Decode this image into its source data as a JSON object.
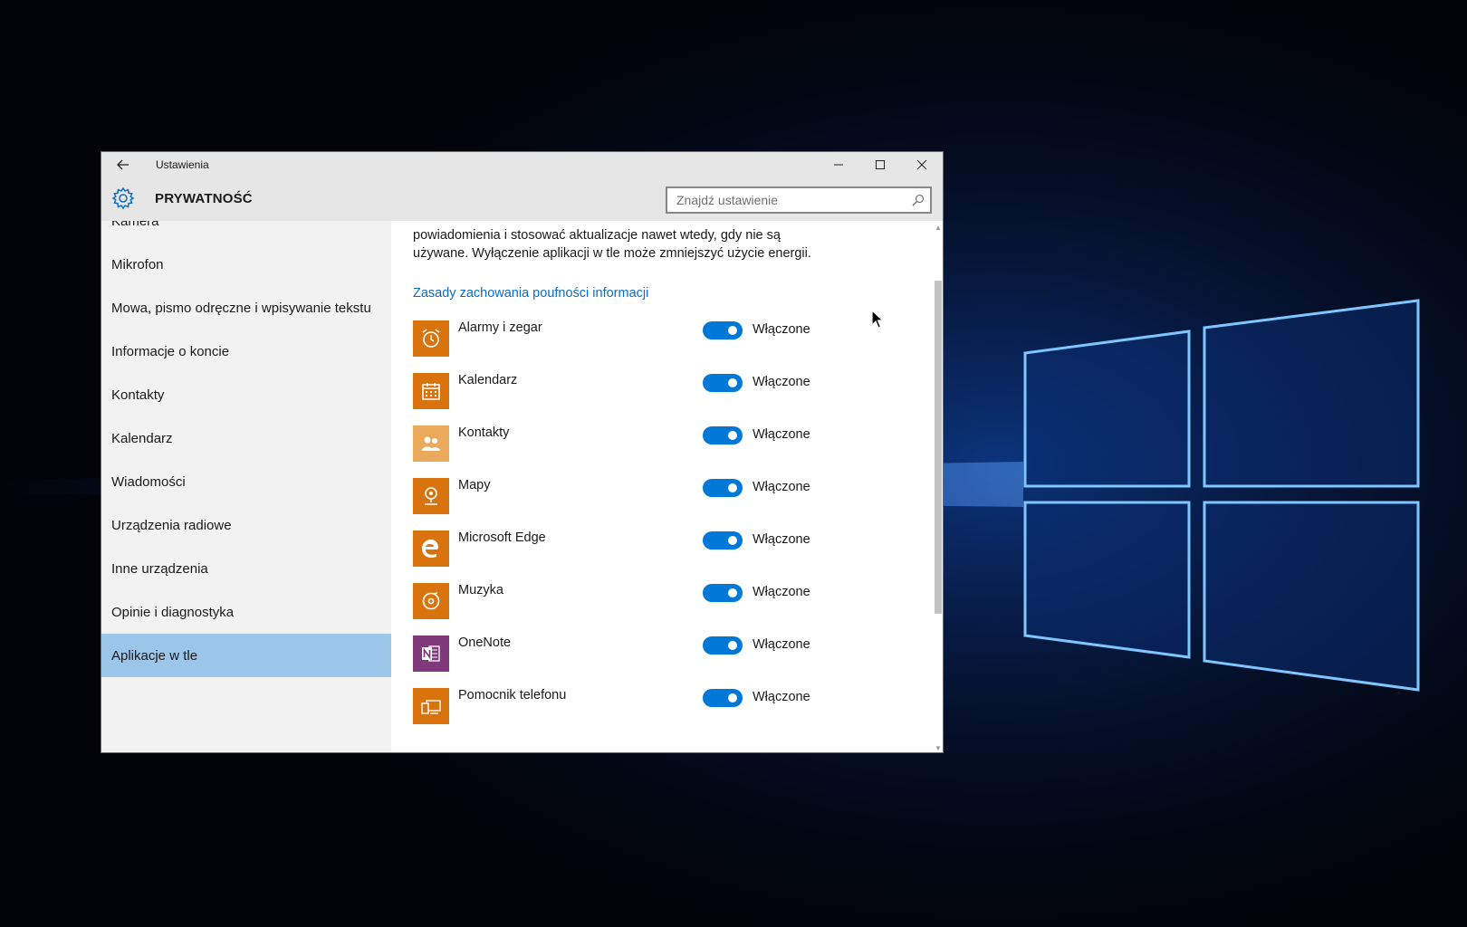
{
  "window": {
    "title": "Ustawienia",
    "section_title": "PRYWATNOŚĆ",
    "search_placeholder": "Znajdź ustawienie"
  },
  "sidebar": {
    "items": [
      {
        "label": "Kamera",
        "selected": false
      },
      {
        "label": "Mikrofon",
        "selected": false
      },
      {
        "label": "Mowa, pismo odręczne i wpisywanie tekstu",
        "selected": false
      },
      {
        "label": "Informacje o koncie",
        "selected": false
      },
      {
        "label": "Kontakty",
        "selected": false
      },
      {
        "label": "Kalendarz",
        "selected": false
      },
      {
        "label": "Wiadomości",
        "selected": false
      },
      {
        "label": "Urządzenia radiowe",
        "selected": false
      },
      {
        "label": "Inne urządzenia",
        "selected": false
      },
      {
        "label": "Opinie i diagnostyka",
        "selected": false
      },
      {
        "label": "Aplikacje w tle",
        "selected": true
      }
    ]
  },
  "main": {
    "description_line1": "powiadomienia i stosować aktualizacje nawet wtedy, gdy nie są",
    "description_line2": "używane. Wyłączenie aplikacji w tle może zmniejszyć użycie energii.",
    "privacy_link": "Zasady zachowania poufności informacji",
    "apps": [
      {
        "name": "Alarmy i zegar",
        "icon": "alarm-clock-icon",
        "color": "#d9730d",
        "toggle_on": true,
        "toggle_label": "Włączone"
      },
      {
        "name": "Kalendarz",
        "icon": "calendar-icon",
        "color": "#d9730d",
        "toggle_on": true,
        "toggle_label": "Włączone"
      },
      {
        "name": "Kontakty",
        "icon": "people-icon",
        "color": "#eba95c",
        "toggle_on": true,
        "toggle_label": "Włączone"
      },
      {
        "name": "Mapy",
        "icon": "maps-icon",
        "color": "#d9730d",
        "toggle_on": true,
        "toggle_label": "Włączone"
      },
      {
        "name": "Microsoft Edge",
        "icon": "edge-icon",
        "color": "#d9730d",
        "toggle_on": true,
        "toggle_label": "Włączone"
      },
      {
        "name": "Muzyka",
        "icon": "music-icon",
        "color": "#d9730d",
        "toggle_on": true,
        "toggle_label": "Włączone"
      },
      {
        "name": "OneNote",
        "icon": "onenote-icon",
        "color": "#80397b",
        "toggle_on": true,
        "toggle_label": "Włączone"
      },
      {
        "name": "Pomocnik telefonu",
        "icon": "phone-companion-icon",
        "color": "#d9730d",
        "toggle_on": true,
        "toggle_label": "Włączone"
      }
    ]
  },
  "colors": {
    "accent": "#0078d7",
    "selected_nav": "#9cc5ea",
    "link": "#0a6cc4"
  }
}
